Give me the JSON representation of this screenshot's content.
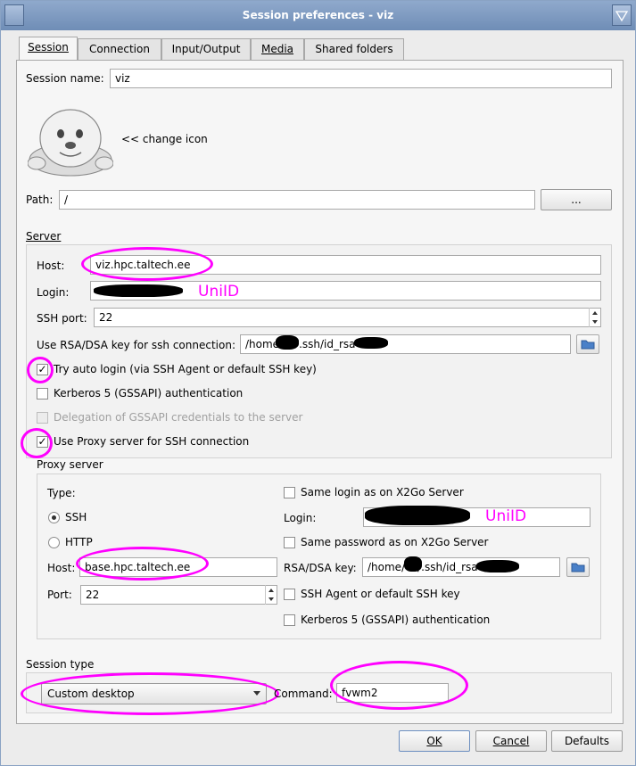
{
  "window": {
    "title": "Session preferences - viz"
  },
  "tabs": [
    {
      "label": "Session",
      "active": true
    },
    {
      "label": "Connection"
    },
    {
      "label": "Input/Output"
    },
    {
      "label": "Media"
    },
    {
      "label": "Shared folders"
    }
  ],
  "session": {
    "name_label": "Session name:",
    "name_value": "viz",
    "change_icon_label": "<< change icon",
    "path_label": "Path:",
    "path_value": "/",
    "path_browse_label": "..."
  },
  "server": {
    "group_label": "Server",
    "host_label": "Host:",
    "host_value": "viz.hpc.taltech.ee",
    "login_label": "Login:",
    "login_annotation": "UniID",
    "ssh_port_label": "SSH port:",
    "ssh_port_value": "22",
    "key_label": "Use RSA/DSA key for ssh connection:",
    "key_value_start": "/home",
    "key_value_mid": ".ssh/id_rsa",
    "try_auto_login_label": "Try auto login (via SSH Agent or default SSH key)",
    "try_auto_login_checked": true,
    "kerberos_label": "Kerberos 5 (GSSAPI) authentication",
    "kerberos_checked": false,
    "delegation_label": "Delegation of GSSAPI credentials to the server",
    "delegation_checked": false,
    "use_proxy_label": "Use Proxy server for SSH connection",
    "use_proxy_checked": true
  },
  "proxy": {
    "group_label": "Proxy server",
    "type_label": "Type:",
    "type_options": [
      "SSH",
      "HTTP"
    ],
    "type_selected": "SSH",
    "host_label": "Host:",
    "host_value": "base.hpc.taltech.ee",
    "port_label": "Port:",
    "port_value": "22",
    "same_login_label": "Same login as on X2Go Server",
    "login_label": "Login:",
    "login_annotation": "UniID",
    "same_password_label": "Same password as on X2Go Server",
    "key_label": "RSA/DSA key:",
    "key_value_start": "/home/",
    "key_value_mid": "/.ssh/id_rsa",
    "ssh_agent_label": "SSH Agent or default SSH key",
    "kerberos_label": "Kerberos 5 (GSSAPI) authentication"
  },
  "session_type": {
    "group_label": "Session type",
    "selected": "Custom desktop",
    "command_label": "Command:",
    "command_value": "fvwm2"
  },
  "buttons": {
    "ok": "OK",
    "cancel": "Cancel",
    "defaults": "Defaults"
  },
  "colors": {
    "annotation": "#ff00ff",
    "titlebar": "#7b97bf"
  },
  "icons": [
    "seal-icon",
    "folder-open-icon",
    "chevron-down-icon",
    "spin-up-icon",
    "spin-down-icon"
  ]
}
